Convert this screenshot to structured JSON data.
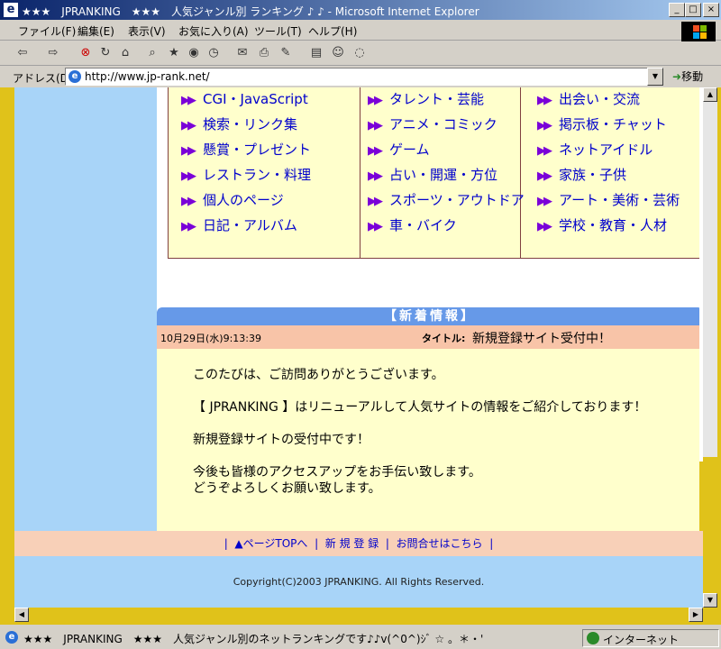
{
  "window": {
    "title": "★★★　JPRANKING　★★★　人気ジャンル別 ランキング ♪ ♪ - Microsoft Internet Explorer",
    "minimize": "_",
    "maximize": "□",
    "close": "×"
  },
  "menu": [
    "ファイル(F)",
    "編集(E)",
    "表示(V)",
    "お気に入り(A)",
    "ツール(T)",
    "ヘルプ(H)"
  ],
  "toolbar_icons": [
    "back-icon",
    "forward-icon",
    "stop-icon",
    "refresh-icon",
    "home-icon",
    "search-icon",
    "favorites-icon",
    "media-icon",
    "history-icon",
    "mail-icon",
    "print-icon",
    "edit-icon",
    "discuss-icon",
    "messenger-icon"
  ],
  "address": {
    "label": "アドレス(D)",
    "url": "http://www.jp-rank.net/",
    "go_label": "移動"
  },
  "categories": {
    "col1": [
      "CGI・JavaScript",
      "検索・リンク集",
      "懸賞・プレゼント",
      "レストラン・料理",
      "個人のページ",
      "日記・アルバム"
    ],
    "col2": [
      "タレント・芸能",
      "アニメ・コミック",
      "ゲーム",
      "占い・開運・方位",
      "スポーツ・アウトドア",
      "車・バイク"
    ],
    "col3": [
      "出会い・交流",
      "掲示板・チャット",
      "ネットアイドル",
      "家族・子供",
      "アート・美術・芸術",
      "学校・教育・人材"
    ]
  },
  "news": {
    "heading": "【新着情報】",
    "date": "10月29日(水)9:13:39",
    "title_label": "タイトル:",
    "title": "新規登録サイト受付中！",
    "body": {
      "line1": "このたびは、ご訪問ありがとうございます。",
      "line2": "【 JPRANKING 】はリニューアルして人気サイトの情報をご紹介しております！",
      "line3": "新規登録サイトの受付中です！",
      "line4": "今後も皆様のアクセスアップをお手伝い致します。",
      "line5": "どうぞよろしくお願い致します。"
    }
  },
  "footer": {
    "link_top": "▲ページTOPへ",
    "link_register": "新 規 登 録",
    "link_contact": "お問合せはこちら",
    "separator": "|",
    "copyright": "Copyright(C)2003 JPRANKING. All Rights Reserved."
  },
  "status": {
    "text": "★★★　JPRANKING　★★★　人気ジャンル別のネットランキングです♪♪v(^0^)ｼﾞ ☆ 。＊・'",
    "zone": "インターネット"
  },
  "colors": {
    "titlebar": "#0a246a",
    "left_column": "#a8d4f8",
    "category_bg": "#ffffcc",
    "news_header": "#6699e8",
    "news_meta": "#f8c4a8",
    "frame_yellow": "#e0c21a",
    "link_blue": "#0000cc",
    "arrow_purple": "#7a00d8"
  }
}
